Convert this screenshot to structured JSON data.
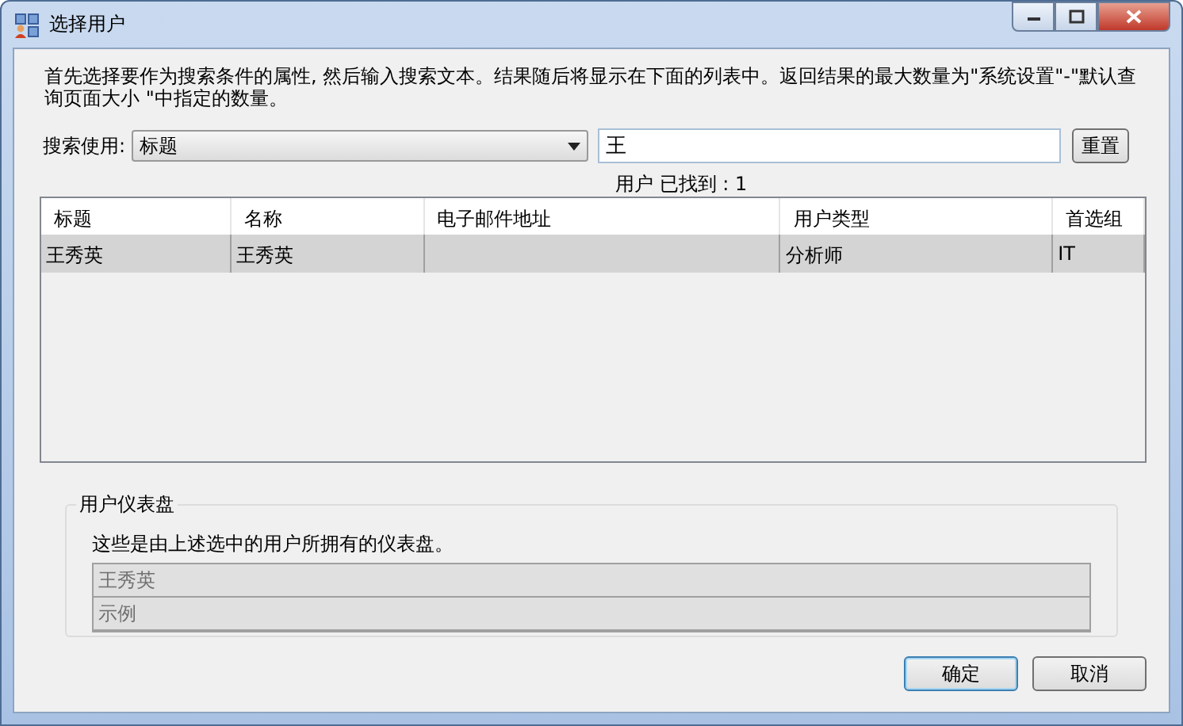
{
  "window": {
    "title": "选择用户"
  },
  "description": "首先选择要作为搜索条件的属性, 然后输入搜索文本。结果随后将显示在下面的列表中。返回结果的最大数量为\"系统设置\"-\"默认查询页面大小 \"中指定的数量。",
  "search": {
    "label": "搜索使用:",
    "attribute": "标题",
    "value": "王",
    "reset_button": "重置"
  },
  "found": "用户 已找到 : 1",
  "table": {
    "columns": [
      "标题",
      "名称",
      "电子邮件地址",
      "用户类型",
      "首选组"
    ],
    "rows": [
      {
        "cells": [
          "王秀英",
          "王秀英",
          "",
          "分析师",
          "IT"
        ],
        "selected": true
      }
    ]
  },
  "dashboards": {
    "legend": "用户仪表盘",
    "note": "这些是由上述选中的用户所拥有的仪表盘。",
    "items": [
      "王秀英",
      "示例"
    ]
  },
  "buttons": [
    {
      "label": "确定",
      "default": true
    },
    {
      "label": "取消",
      "default": false
    }
  ]
}
